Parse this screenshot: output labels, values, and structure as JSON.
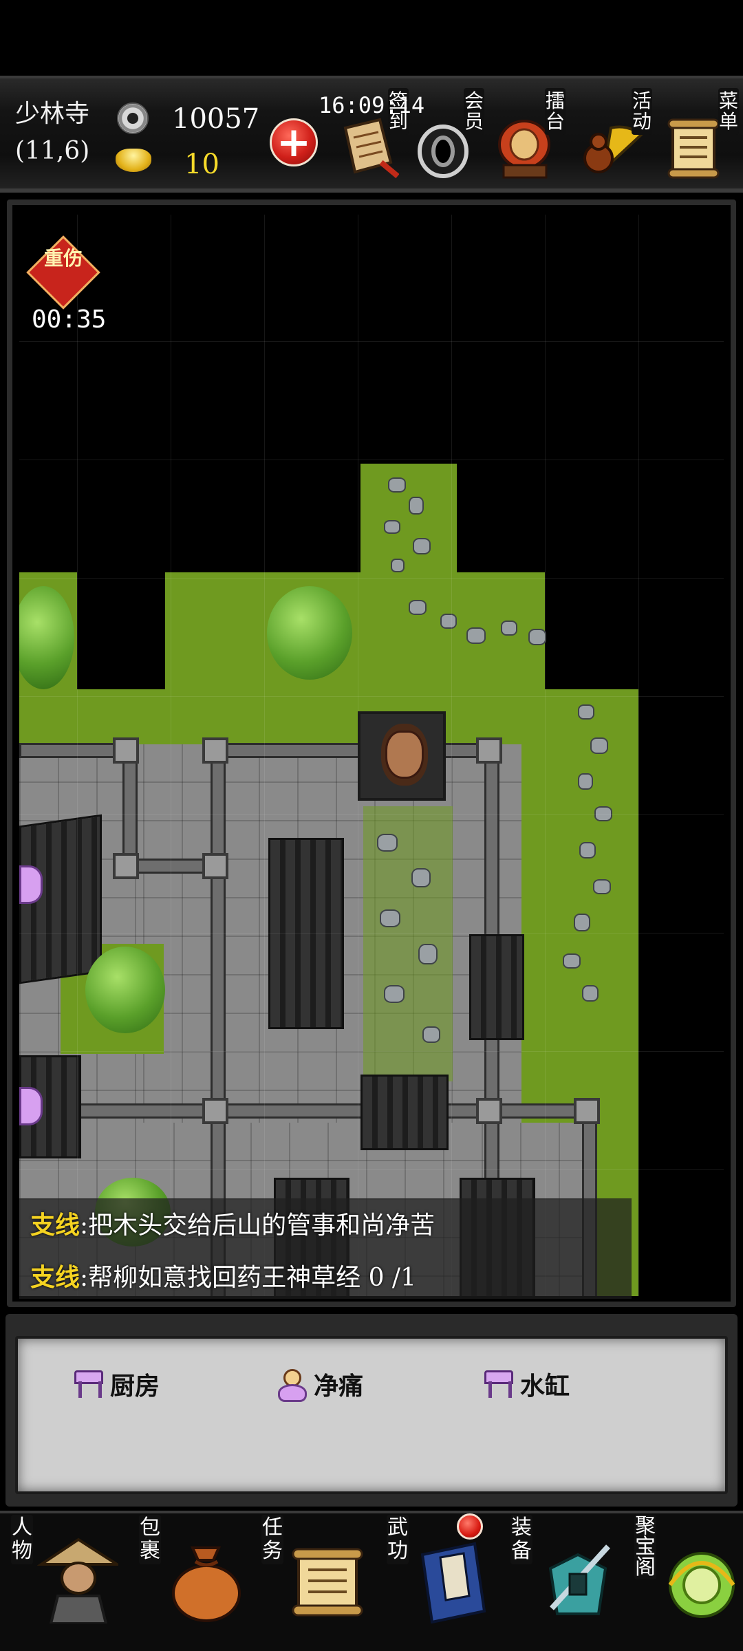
{
  "hud": {
    "location": "少林寺",
    "coords": "(11,6)",
    "silver": "10057",
    "gold": "10",
    "timer": "16:09:14",
    "buttons": [
      {
        "label": "签到",
        "icon": "scroll-brush-icon"
      },
      {
        "label": "会员",
        "icon": "vip-ring-icon"
      },
      {
        "label": "擂台",
        "icon": "war-drum-icon"
      },
      {
        "label": "活动",
        "icon": "fan-gourd-icon"
      },
      {
        "label": "菜单",
        "icon": "menu-scroll-icon"
      }
    ]
  },
  "status_effect": {
    "label": "重伤",
    "timer": "00:35"
  },
  "quests": [
    {
      "tag": "支线",
      "text": ":把木头交给后山的管事和尚净苦"
    },
    {
      "tag": "支线",
      "text": ":帮柳如意找回药王神草经 0 /1"
    }
  ],
  "nearby": [
    {
      "type": "place",
      "name": "厨房",
      "icon": "pavilion-icon"
    },
    {
      "type": "npc",
      "name": "净痛",
      "icon": "person-icon"
    },
    {
      "type": "place",
      "name": "水缸",
      "icon": "pavilion-icon"
    }
  ],
  "nav": [
    {
      "label": "人物",
      "icon": "straw-hat-man-icon"
    },
    {
      "label": "包裹",
      "icon": "pouch-icon"
    },
    {
      "label": "任务",
      "icon": "quest-scroll-icon"
    },
    {
      "label": "武功",
      "icon": "martial-book-icon",
      "badge": true
    },
    {
      "label": "装备",
      "icon": "armor-sword-icon"
    },
    {
      "label": "聚宝阁",
      "icon": "treasure-icon"
    }
  ],
  "colors": {
    "gold_text": "#f6da2a",
    "quest_tag": "#f5d321",
    "grass": "#6f9a20",
    "stone": "#8a8a8a"
  }
}
